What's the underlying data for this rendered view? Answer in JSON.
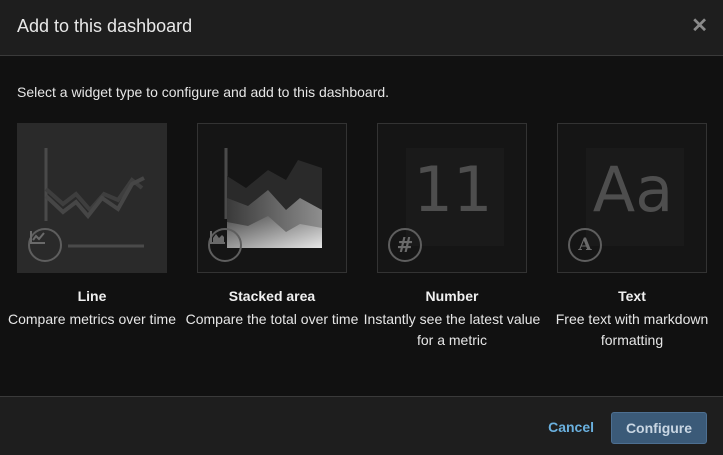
{
  "dialog": {
    "title": "Add to this dashboard",
    "close_icon": "close-icon",
    "instructions": "Select a widget type to configure and add to this dashboard."
  },
  "widgets": [
    {
      "name": "Line",
      "description": "Compare metrics over time",
      "icon": "line-chart-icon",
      "selected": true
    },
    {
      "name": "Stacked area",
      "description": "Compare the total over time",
      "icon": "area-chart-icon",
      "selected": false
    },
    {
      "name": "Number",
      "description": "Instantly see the latest value for a metric",
      "icon": "hash-icon",
      "preview_text": "11",
      "badge_glyph": "#",
      "selected": false
    },
    {
      "name": "Text",
      "description": "Free text with markdown formatting",
      "icon": "text-icon",
      "preview_text": "Aa",
      "badge_glyph": "A",
      "selected": false
    }
  ],
  "footer": {
    "cancel_label": "Cancel",
    "configure_label": "Configure"
  },
  "colors": {
    "background": "#111111",
    "header_footer": "#1e1e1e",
    "link": "#6ab0de",
    "primary_button": "#3b5a78"
  }
}
